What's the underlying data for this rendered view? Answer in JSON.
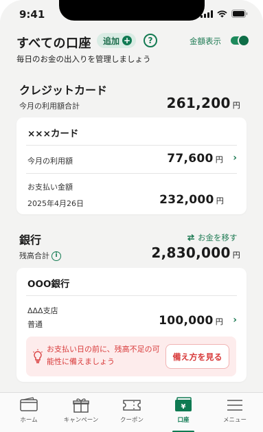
{
  "status_bar": {
    "time": "9:41"
  },
  "header": {
    "title": "すべての口座",
    "add_label": "追加",
    "help_glyph": "?",
    "amount_toggle_label": "金額表示",
    "amount_toggle_on": true,
    "subtitle": "毎日のお金の出入りを管理しましょう"
  },
  "credit": {
    "title": "クレジットカード",
    "total_label": "今月の利用額合計",
    "total_amount": "261,200",
    "unit": "円",
    "card": {
      "name": "×××カード",
      "usage_label": "今月の利用額",
      "usage_amount": "77,600",
      "payment_label": "お支払い金額",
      "payment_date": "2025年4月26日",
      "payment_amount": "232,000"
    }
  },
  "bank": {
    "title": "銀行",
    "transfer_label": "お金を移す",
    "balance_label": "残高合計",
    "balance_amount": "2,830,000",
    "unit": "円",
    "account": {
      "bank_name": "OOO銀行",
      "branch": "ΔΔΔ支店",
      "type": "普通",
      "amount": "100,000",
      "alert_text": "お支払い日の前に、残高不足の可能性に備えましょう",
      "alert_button": "備え方を見る"
    }
  },
  "tabbar": {
    "tabs": [
      {
        "label": "ホーム",
        "icon": "wallet-icon"
      },
      {
        "label": "キャンペーン",
        "icon": "gift-icon"
      },
      {
        "label": "クーポン",
        "icon": "ticket-icon"
      },
      {
        "label": "口座",
        "icon": "account-yen-icon",
        "active": true
      },
      {
        "label": "メニュー",
        "icon": "menu-icon"
      }
    ]
  },
  "colors": {
    "accent": "#0f7a52",
    "alert_red": "#d83a3a",
    "alert_bg": "#fdecec",
    "background": "#f3f3f2"
  }
}
